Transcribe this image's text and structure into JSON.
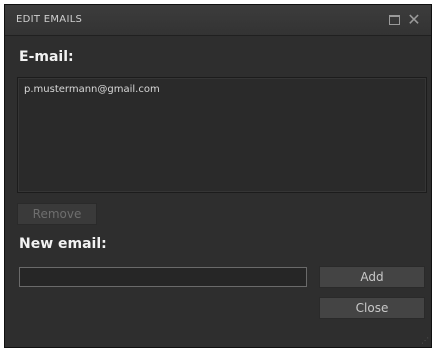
{
  "window": {
    "title": "EDIT EMAILS"
  },
  "icons": {
    "maximize": "maximize-icon",
    "close": "close-icon",
    "resize": "resize-grip-icon"
  },
  "email_section": {
    "label": "E-mail:",
    "items": [
      "p.mustermann@gmail.com"
    ]
  },
  "buttons": {
    "remove": "Remove",
    "add": "Add",
    "close": "Close"
  },
  "new_email": {
    "label": "New email:",
    "value": "",
    "placeholder": ""
  },
  "colors": {
    "background": "#2e2e2e",
    "text": "#f2f2f2",
    "button": "#444444",
    "disabled_text": "#6e6e6e"
  }
}
